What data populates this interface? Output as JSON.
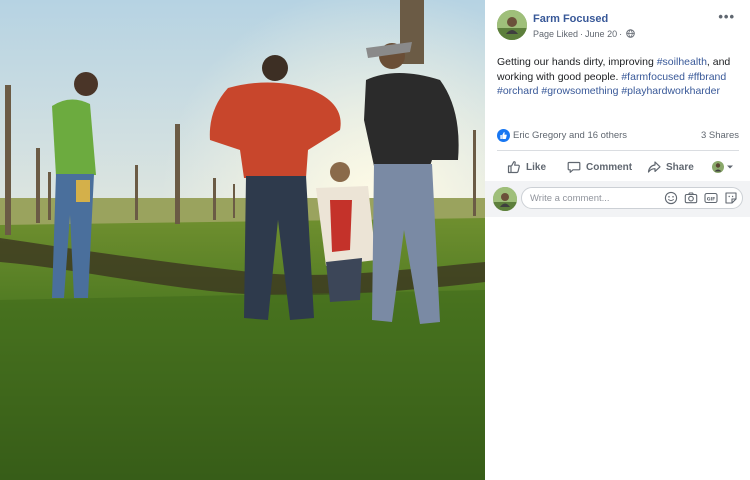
{
  "post": {
    "page_name": "Farm Focused",
    "status": "Page Liked",
    "dot": "·",
    "date": "June 20",
    "dot2": "·",
    "text_segments": [
      {
        "text": "Getting our hands dirty, improving ",
        "type": "text"
      },
      {
        "text": "#soilhealth",
        "type": "tag"
      },
      {
        "text": ", and working with good people. ",
        "type": "text"
      },
      {
        "text": "#farmfocused",
        "type": "tag"
      },
      {
        "text": " ",
        "type": "text"
      },
      {
        "text": "#ffbrand",
        "type": "tag"
      },
      {
        "text": " ",
        "type": "text"
      },
      {
        "text": "#orchard",
        "type": "tag"
      },
      {
        "text": " ",
        "type": "text"
      },
      {
        "text": "#growsomething",
        "type": "tag"
      },
      {
        "text": " ",
        "type": "text"
      },
      {
        "text": "#playhardworkharder",
        "type": "tag"
      }
    ]
  },
  "reactions": {
    "reactors": "Eric Gregory and 16 others",
    "shares": "3 Shares"
  },
  "actions": {
    "like": "Like",
    "comment": "Comment",
    "share": "Share"
  },
  "comment": {
    "placeholder": "Write a comment..."
  },
  "colors": {
    "link_blue": "#385898",
    "facebook_blue": "#1877f2",
    "muted_text": "#606770"
  },
  "icons": [
    "more-icon",
    "globe-icon",
    "like-reaction-icon",
    "like-icon",
    "comment-icon",
    "share-icon",
    "reaction-picker-icon",
    "emoji-icon",
    "camera-icon",
    "gif-icon",
    "sticker-icon"
  ]
}
